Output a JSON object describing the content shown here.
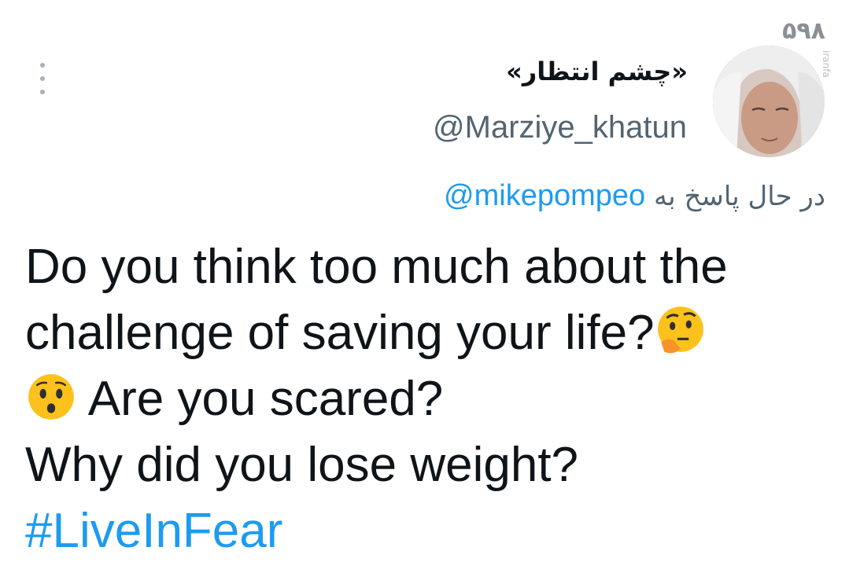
{
  "watermark": {
    "logo": "۵۹۸",
    "sub": "iranfa"
  },
  "profile": {
    "display_name": "«چشم انتظار»",
    "username": "@Marziye_khatun"
  },
  "reply": {
    "prefix": "در حال پاسخ به",
    "handle": "@mikepompeo"
  },
  "tweet": {
    "line1": "Do you think too much about the",
    "line2": "challenge of saving your life?",
    "line3": " Are you scared?",
    "line4": " Why did you lose weight?",
    "hashtag": "#LiveInFear"
  },
  "icons": {
    "more": "more-vertical-icon",
    "emoji1": "thinking-face-emoji",
    "emoji2": "hushed-face-emoji"
  },
  "colors": {
    "link": "#1d9bf0",
    "muted": "#536471",
    "text": "#0f1419"
  }
}
